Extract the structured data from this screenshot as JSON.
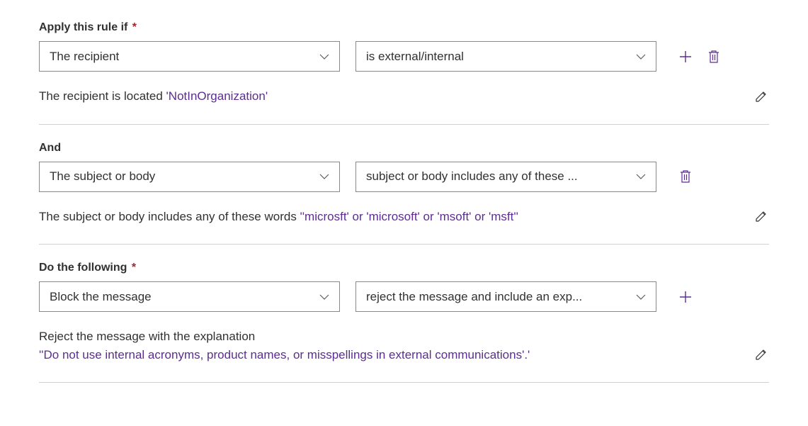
{
  "section1": {
    "label": "Apply this rule if",
    "required": "*",
    "select1": "The recipient",
    "select2": "is external/internal",
    "summary_prefix": "The recipient is located ",
    "summary_value": "'NotInOrganization'"
  },
  "section2": {
    "label": "And",
    "select1": "The subject or body",
    "select2": "subject or body includes any of these ...",
    "summary_prefix": "The subject or body includes any of these words ",
    "summary_value": "''microsft' or 'microsoft' or 'msoft' or 'msft''"
  },
  "section3": {
    "label": "Do the following",
    "required": "*",
    "select1": "Block the message",
    "select2": "reject the message and include an exp...",
    "summary_line1": "Reject the message with the explanation",
    "summary_value": "''Do not use internal acronyms, product names, or misspellings in external communications'.'"
  }
}
